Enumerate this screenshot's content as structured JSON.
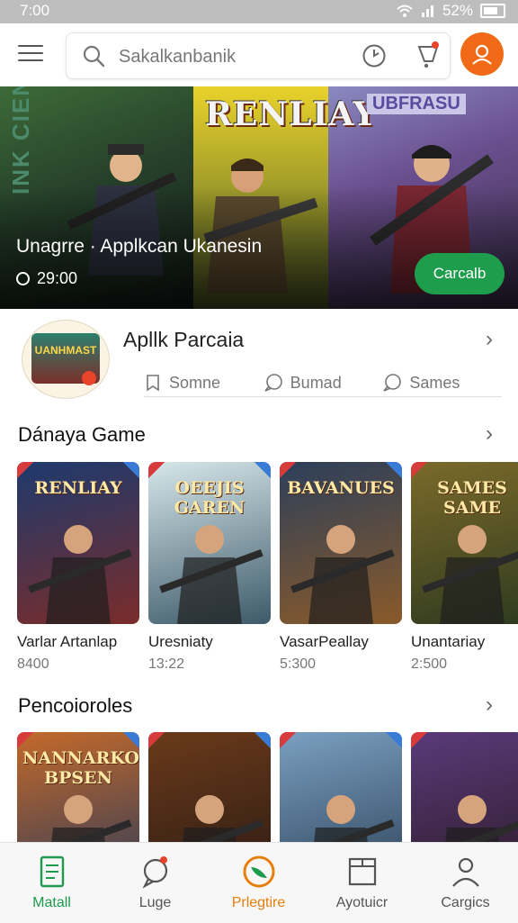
{
  "status_bar": {
    "time": "7:00",
    "battery": "52%"
  },
  "search": {
    "placeholder": "Sakalkanbanik"
  },
  "banner": {
    "side_text": "INK CIENZN",
    "logo_text": "RENLIAY",
    "logo_text_2": "UBFRASU",
    "title": "Unagrre · Applkcan Ukanesin",
    "time": "29:00",
    "button_label": "Carcalb"
  },
  "app_section": {
    "logo_text": "UANHMAST",
    "title": "Apllk Parcaia",
    "tabs": [
      {
        "label": "Somne",
        "icon": "bookmark-icon"
      },
      {
        "label": "Bumad",
        "icon": "chat-icon"
      },
      {
        "label": "Sames",
        "icon": "chat-icon"
      }
    ]
  },
  "sections": [
    {
      "title": "Dánaya Game",
      "games": [
        {
          "name": "Varlar Artanlap",
          "meta": "8400",
          "logo": "RENLIAY",
          "colors": [
            "#1d3a6e",
            "#7a2c2a"
          ]
        },
        {
          "name": "Uresniaty",
          "meta": "13:22",
          "logo": "OEEJIS GAREN",
          "colors": [
            "#d7e7ea",
            "#3d5a6a"
          ]
        },
        {
          "name": "VasarPeallay",
          "meta": "5:300",
          "logo": "BAVANUES",
          "colors": [
            "#2c3f5a",
            "#8a5a2a"
          ]
        },
        {
          "name": "Unantariay",
          "meta": "2:500",
          "logo": "SAMES SAME",
          "colors": [
            "#7b6a2a",
            "#2e3a1f"
          ]
        }
      ]
    },
    {
      "title": "Pencoioroles",
      "games": [
        {
          "name": "",
          "meta": "",
          "logo": "NANNARKO BPSEN",
          "colors": [
            "#c4692a",
            "#2d3b5a"
          ]
        },
        {
          "name": "",
          "meta": "",
          "logo": "",
          "colors": [
            "#6a3a1a",
            "#2a1a14"
          ]
        },
        {
          "name": "",
          "meta": "",
          "logo": "",
          "colors": [
            "#7aa0c0",
            "#2c4058"
          ]
        },
        {
          "name": "",
          "meta": "",
          "logo": "",
          "colors": [
            "#5a3a7a",
            "#2a1a24"
          ]
        }
      ]
    }
  ],
  "bottom_nav": [
    {
      "label": "Matall",
      "icon": "document-icon",
      "state": "active"
    },
    {
      "label": "Luge",
      "icon": "chat-bubble-icon",
      "state": ""
    },
    {
      "label": "Prlegtire",
      "icon": "leaf-icon",
      "state": "featured"
    },
    {
      "label": "Ayotuicr",
      "icon": "folder-icon",
      "state": ""
    },
    {
      "label": "Cargics",
      "icon": "person-icon",
      "state": ""
    }
  ],
  "colors": {
    "accent_green": "#1d9a4c",
    "accent_orange": "#f26a17",
    "badge_red": "#e8432b"
  }
}
